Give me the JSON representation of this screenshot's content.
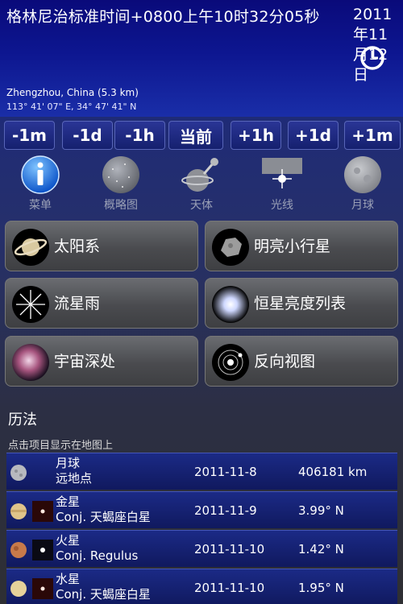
{
  "header": {
    "time_text": "格林尼治标准时间+0800上午10时32分05秒",
    "date_lines": [
      "2011",
      "年11",
      "月12",
      "日"
    ],
    "location": "Zhengzhou, China (5.3 km)",
    "coords": "113° 41' 07\" E, 34° 47' 41\" N"
  },
  "time_steps": [
    "-1m",
    "-1d",
    "-1h",
    "当前",
    "+1h",
    "+1d",
    "+1m"
  ],
  "tools": [
    {
      "label": "菜单",
      "icon": "info-icon"
    },
    {
      "label": "概略图",
      "icon": "sky-map-icon"
    },
    {
      "label": "天体",
      "icon": "push-pin-planet-icon"
    },
    {
      "label": "光线",
      "icon": "light-star-icon"
    },
    {
      "label": "月球",
      "icon": "moon-icon"
    }
  ],
  "categories": [
    {
      "label": "太阳系",
      "icon": "saturn-icon"
    },
    {
      "label": "明亮小行星",
      "icon": "asteroid-icon"
    },
    {
      "label": "流星雨",
      "icon": "meteor-shower-icon"
    },
    {
      "label": "恒星亮度列表",
      "icon": "bright-star-icon"
    },
    {
      "label": "宇宙深处",
      "icon": "nebula-icon"
    },
    {
      "label": "反向视图",
      "icon": "orbit-icon"
    }
  ],
  "almanac": {
    "title": "历法",
    "hint": "点击项目显示在地图上",
    "events": [
      {
        "name": "月球",
        "desc": "远地点",
        "date": "2011-11-8",
        "value": "406181 km",
        "icons": [
          "moon-icon"
        ]
      },
      {
        "name": "金星",
        "desc": "Conj. 天蝎座白星",
        "date": "2011-11-9",
        "value": "3.99° N",
        "icons": [
          "venus-icon",
          "star-icon"
        ]
      },
      {
        "name": "火星",
        "desc": "Conj. Regulus",
        "date": "2011-11-10",
        "value": "1.42° N",
        "icons": [
          "mars-icon",
          "star-icon"
        ]
      },
      {
        "name": "水星",
        "desc": "Conj. 天蝎座白星",
        "date": "2011-11-10",
        "value": "1.95° N",
        "icons": [
          "mercury-icon",
          "star-icon"
        ]
      }
    ]
  }
}
